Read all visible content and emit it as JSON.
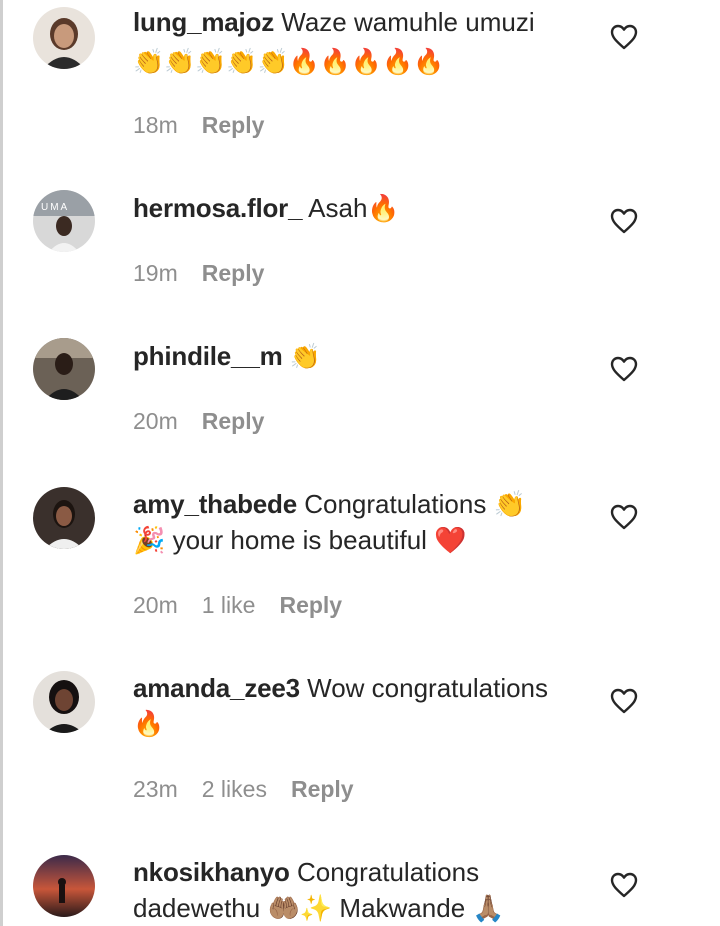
{
  "comments": [
    {
      "username": "lung_majoz",
      "text": "Waze wamuhle umuzi",
      "emoji_line": "👏👏👏👏👏🔥🔥🔥🔥🔥",
      "time": "18m",
      "likes": "",
      "reply": "Reply"
    },
    {
      "username": "hermosa.flor_",
      "text": "Asah🔥",
      "time": "19m",
      "likes": "",
      "reply": "Reply"
    },
    {
      "username": "phindile__m",
      "text": "👏",
      "time": "20m",
      "likes": "",
      "reply": "Reply"
    },
    {
      "username": "amy_thabede",
      "text": "Congratulations 👏",
      "text_line2": "🎉 your home is beautiful ❤️",
      "time": "20m",
      "likes": "1 like",
      "reply": "Reply"
    },
    {
      "username": "amanda_zee3",
      "text": "Wow congratulations",
      "text_line2": "🔥",
      "time": "23m",
      "likes": "2 likes",
      "reply": "Reply"
    },
    {
      "username": "nkosikhanyo",
      "text": "Congratulations",
      "text_line2": "dadewethu 🤲🏽✨ Makwande 🙏🏽",
      "time": "",
      "likes": "",
      "reply": ""
    }
  ],
  "icons": {
    "like": "heart-outline-icon"
  },
  "colors": {
    "text": "#262626",
    "meta": "#8e8e8e",
    "heart_stroke": "#262626"
  }
}
